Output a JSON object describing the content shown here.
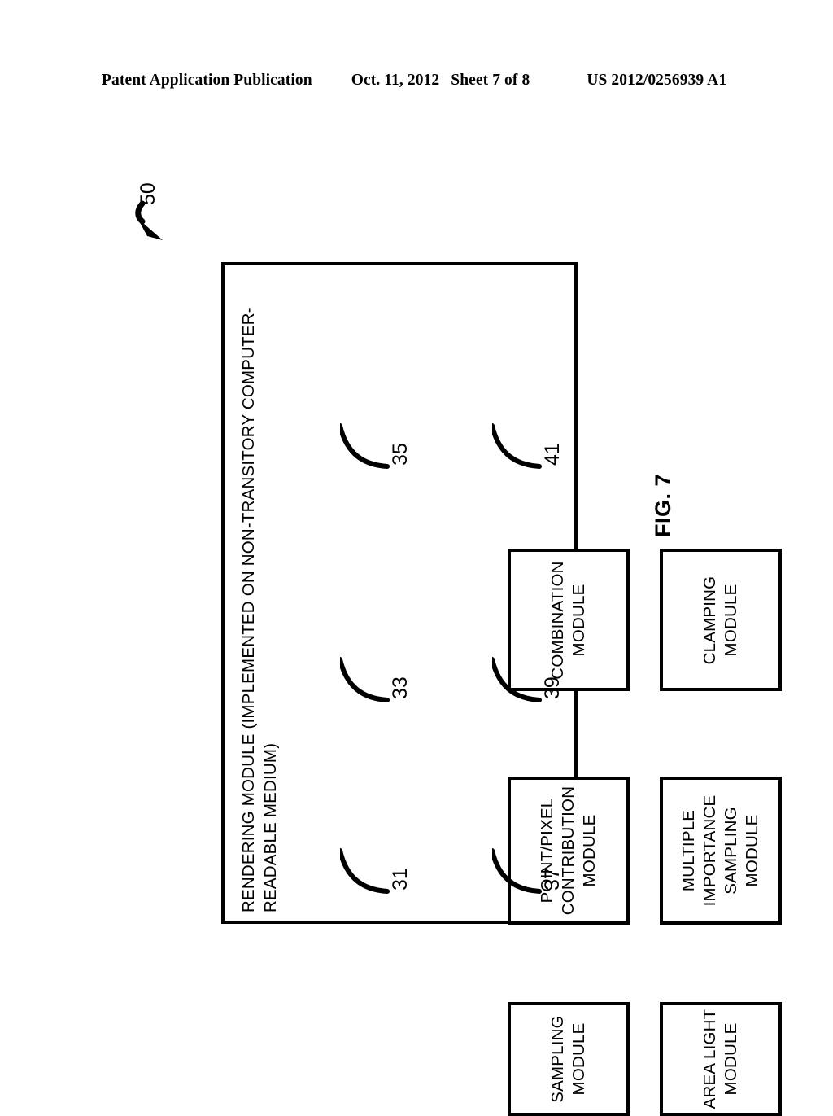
{
  "header": {
    "publication": "Patent Application Publication",
    "date": "Oct. 11, 2012",
    "sheet": "Sheet 7 of 8",
    "number": "US 2012/0256939 A1"
  },
  "figure": {
    "label": "FIG. 7",
    "system_ref": "50"
  },
  "container": {
    "title_line1": "RENDERING MODULE (IMPLEMENTED ON NON-TRANSITORY COMPUTER-",
    "title_line2": "READABLE MEDIUM)"
  },
  "modules": [
    {
      "id": "combination",
      "ref": "35",
      "lines": [
        "COMBINATION",
        "MODULE"
      ]
    },
    {
      "id": "clamping",
      "ref": "41",
      "lines": [
        "CLAMPING",
        "MODULE"
      ]
    },
    {
      "id": "point-pixel",
      "ref": "33",
      "lines": [
        "POINT/PIXEL",
        "CONTRIBUTION",
        "MODULE"
      ]
    },
    {
      "id": "multiple-importance-sampling",
      "ref": "39",
      "lines": [
        "MULTIPLE",
        "IMPORTANCE",
        "SAMPLING",
        "MODULE"
      ]
    },
    {
      "id": "sampling",
      "ref": "31",
      "lines": [
        "SAMPLING",
        "MODULE"
      ]
    },
    {
      "id": "area-light",
      "ref": "37",
      "lines": [
        "AREA LIGHT",
        "MODULE"
      ]
    }
  ],
  "colors": {
    "ink": "#000000",
    "paper": "#ffffff"
  }
}
